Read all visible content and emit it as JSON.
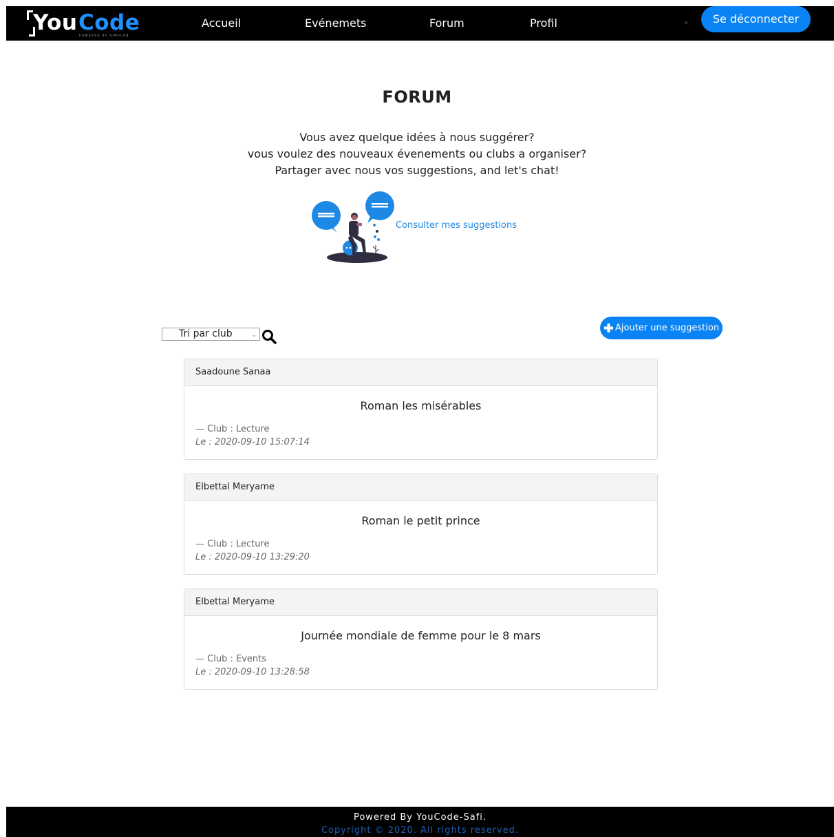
{
  "navbar": {
    "logo": {
      "you": "You",
      "code": "Code",
      "tagline": "POWERED BY SIMPLON"
    },
    "links": [
      {
        "label": "Accueil"
      },
      {
        "label": "Evénemets"
      },
      {
        "label": "Forum"
      },
      {
        "label": "Profil"
      }
    ],
    "logout_label": "Se déconnecter"
  },
  "main": {
    "title": "FORUM",
    "intro_lines": [
      "Vous avez quelque idées à nous suggérer?",
      "vous voulez des nouveaux évenements ou clubs a organiser?",
      "Partager avec nous vos suggestions, and let's chat!"
    ],
    "my_suggestions_link": "Consulter mes suggestions",
    "sort_select_value": "Tri par club",
    "add_suggestion_label": "Ajouter une suggestion"
  },
  "suggestions": [
    {
      "author": "Saadoune Sanaa",
      "title": "Roman les misérables",
      "club": "— Club : Lecture",
      "date": "Le : 2020-09-10 15:07:14"
    },
    {
      "author": "Elbettal Meryame",
      "title": "Roman le petit prince",
      "club": "— Club : Lecture",
      "date": "Le : 2020-09-10 13:29:20"
    },
    {
      "author": "Elbettal Meryame",
      "title": "Journée mondiale de femme pour le 8 mars",
      "club": "— Club : Events",
      "date": "Le : 2020-09-10 13:28:58"
    }
  ],
  "footer": {
    "powered": "Powered By YouCode-Safi.",
    "copyright": "Copyright © 2020. All rights reserved."
  },
  "colors": {
    "accent": "#0a84f5",
    "navbar_bg": "#000000",
    "link": "#1e88e5"
  },
  "icons": {
    "search": "search-icon",
    "plus": "plus-icon",
    "caret": "chevron-down-icon"
  }
}
